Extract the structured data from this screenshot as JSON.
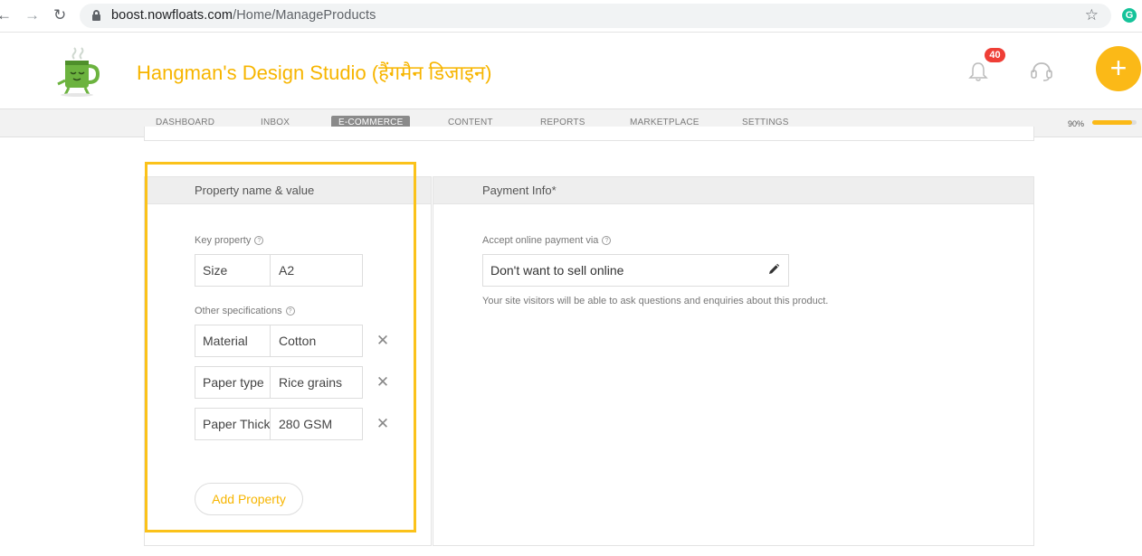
{
  "browser": {
    "url_domain": "boost.nowfloats.com",
    "url_path": "/Home/ManageProducts",
    "extension_label": "G"
  },
  "header": {
    "site_title": "Hangman's Design Studio (हैंगमैन डिजाइन)",
    "notification_count": "40",
    "fab_label": "+"
  },
  "nav": {
    "items": [
      "DASHBOARD",
      "INBOX",
      "E-COMMERCE",
      "CONTENT",
      "REPORTS",
      "MARKETPLACE",
      "SETTINGS"
    ],
    "active": "E-COMMERCE",
    "progress_label": "90%",
    "progress_value": 0.9
  },
  "property_panel": {
    "title": "Property name & value",
    "key_property_label": "Key property",
    "key_property": {
      "name": "Size",
      "value": "A2"
    },
    "other_specs_label": "Other specifications",
    "specs": [
      {
        "name": "Material",
        "value": "Cotton"
      },
      {
        "name": "Paper type",
        "value": "Rice grains"
      },
      {
        "name": "Paper Thickness",
        "value": "280 GSM"
      }
    ],
    "remove_symbol": "✕",
    "add_button": "Add Property"
  },
  "payment_panel": {
    "title": "Payment Info*",
    "accept_label": "Accept online payment via",
    "selected_option": "Don't want to sell online",
    "note": "Your site visitors will be able to ask questions and enquiries about this product."
  },
  "colors": {
    "accent": "#fbb917",
    "highlight": "#fbc21a",
    "badge": "#ef3e36"
  }
}
